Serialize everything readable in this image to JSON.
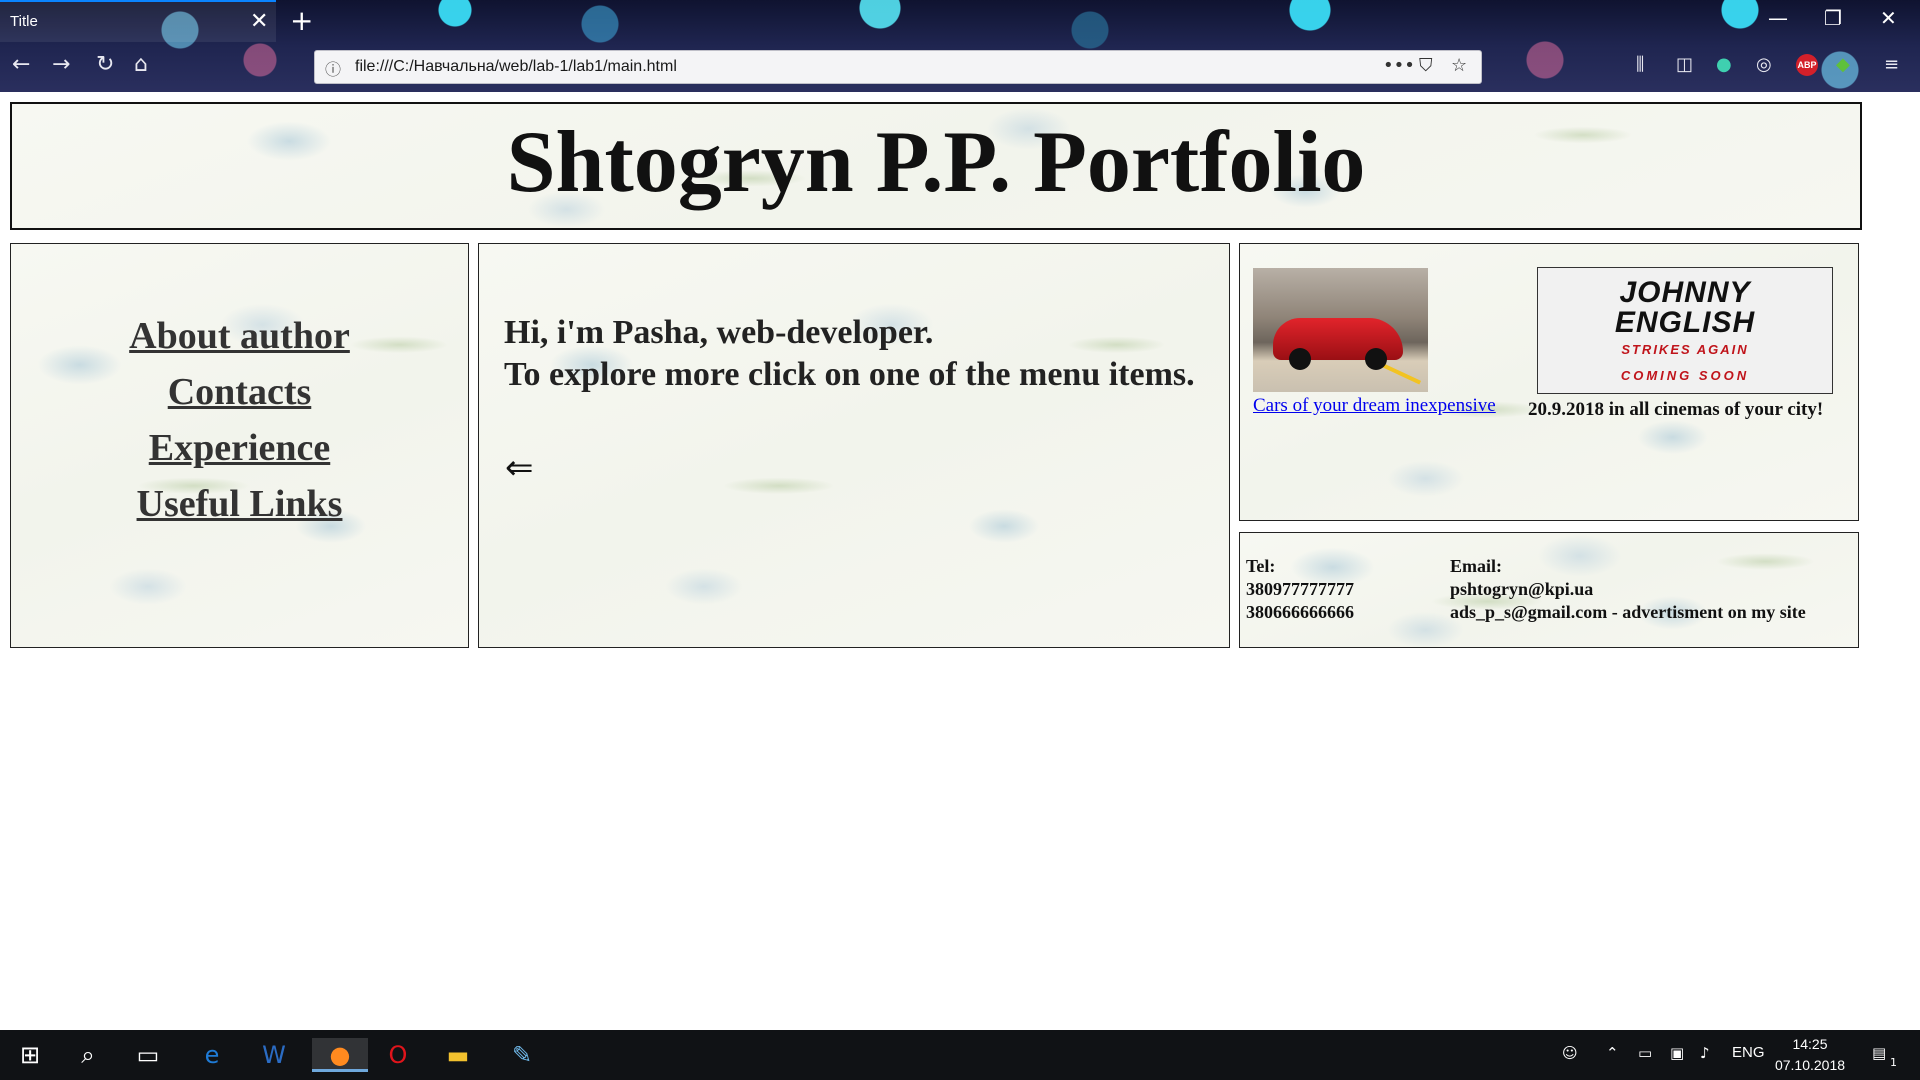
{
  "browser": {
    "tab_title": "Title",
    "tab_close": "✕",
    "new_tab": "+",
    "url": "file:///C:/Навчальна/web/lab-1/lab1/main.html",
    "page_actions": "•••",
    "window_controls": {
      "minimize": "—",
      "restore": "❐",
      "close": "✕"
    },
    "icons": [
      "back-icon",
      "forward-icon",
      "reload-icon",
      "home-icon",
      "info-icon",
      "pocket-icon",
      "bookmark-star-icon",
      "library-icon",
      "sidebar-icon",
      "adblock-icon",
      "menu-icon"
    ],
    "adblock_label": "ABP"
  },
  "page": {
    "title": "Shtogryn P.P. Portfolio",
    "menu": [
      "About author",
      "Contacts",
      "Experience",
      "Useful Links"
    ],
    "greeting": {
      "line1": "Hi, i'm Pasha, web-developer.",
      "line2": "To explore more click on one of the menu items.",
      "arrow": "⇐"
    },
    "ads": {
      "car_link": "Cars of your dream inexpensive",
      "movie_poster": {
        "title_line1": "JOHNNY",
        "title_line2": "ENGLISH",
        "subtitle": "STRIKES AGAIN",
        "coming": "COMING SOON"
      },
      "movie_caption": "20.9.2018 in all cinemas of your city!"
    },
    "contacts": {
      "tel_label": "Tel:",
      "tel1": "380977777777",
      "tel2": "380666666666",
      "email_label": "Email:",
      "email1": "pshtogryn@kpi.ua",
      "email2": "ads_p_s@gmail.com - advertisment on my site"
    }
  },
  "taskbar": {
    "apps": [
      "windows-start-icon",
      "search-icon",
      "task-view-icon",
      "edge-icon",
      "word-icon",
      "firefox-icon",
      "opera-icon",
      "file-explorer-icon",
      "paint-icon"
    ],
    "language": "ENG",
    "time": "14:25",
    "date": "07.10.2018",
    "notification_count": "1"
  }
}
